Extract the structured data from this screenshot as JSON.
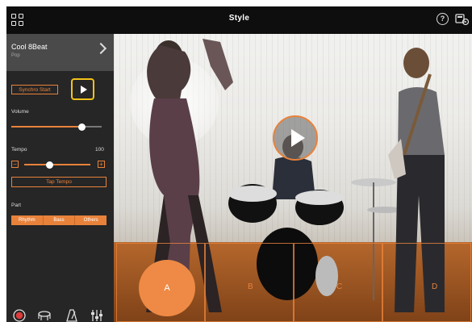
{
  "header": {
    "title": "Style",
    "help_icon": "?"
  },
  "sidebar": {
    "style_name": "Cool 8Beat",
    "style_category": "Pop",
    "synchro_start_label": "Synchro Start",
    "volume_label": "Volume",
    "volume_value": 0.78,
    "tempo_label": "Tempo",
    "tempo_value": "100",
    "tempo_minus": "−",
    "tempo_plus": "+",
    "tap_tempo_label": "Tap Tempo",
    "part_label": "Part",
    "parts": [
      "Rhythm",
      "Bass",
      "Others"
    ]
  },
  "sections": [
    "A",
    "B",
    "C",
    "D"
  ],
  "colors": {
    "accent": "#e8823b",
    "play_highlight": "#f4c21a"
  },
  "icons": [
    "grid-icon",
    "help-icon",
    "tools-icon",
    "record-icon",
    "rhythm-icon",
    "metronome-icon",
    "mixer-icon"
  ]
}
